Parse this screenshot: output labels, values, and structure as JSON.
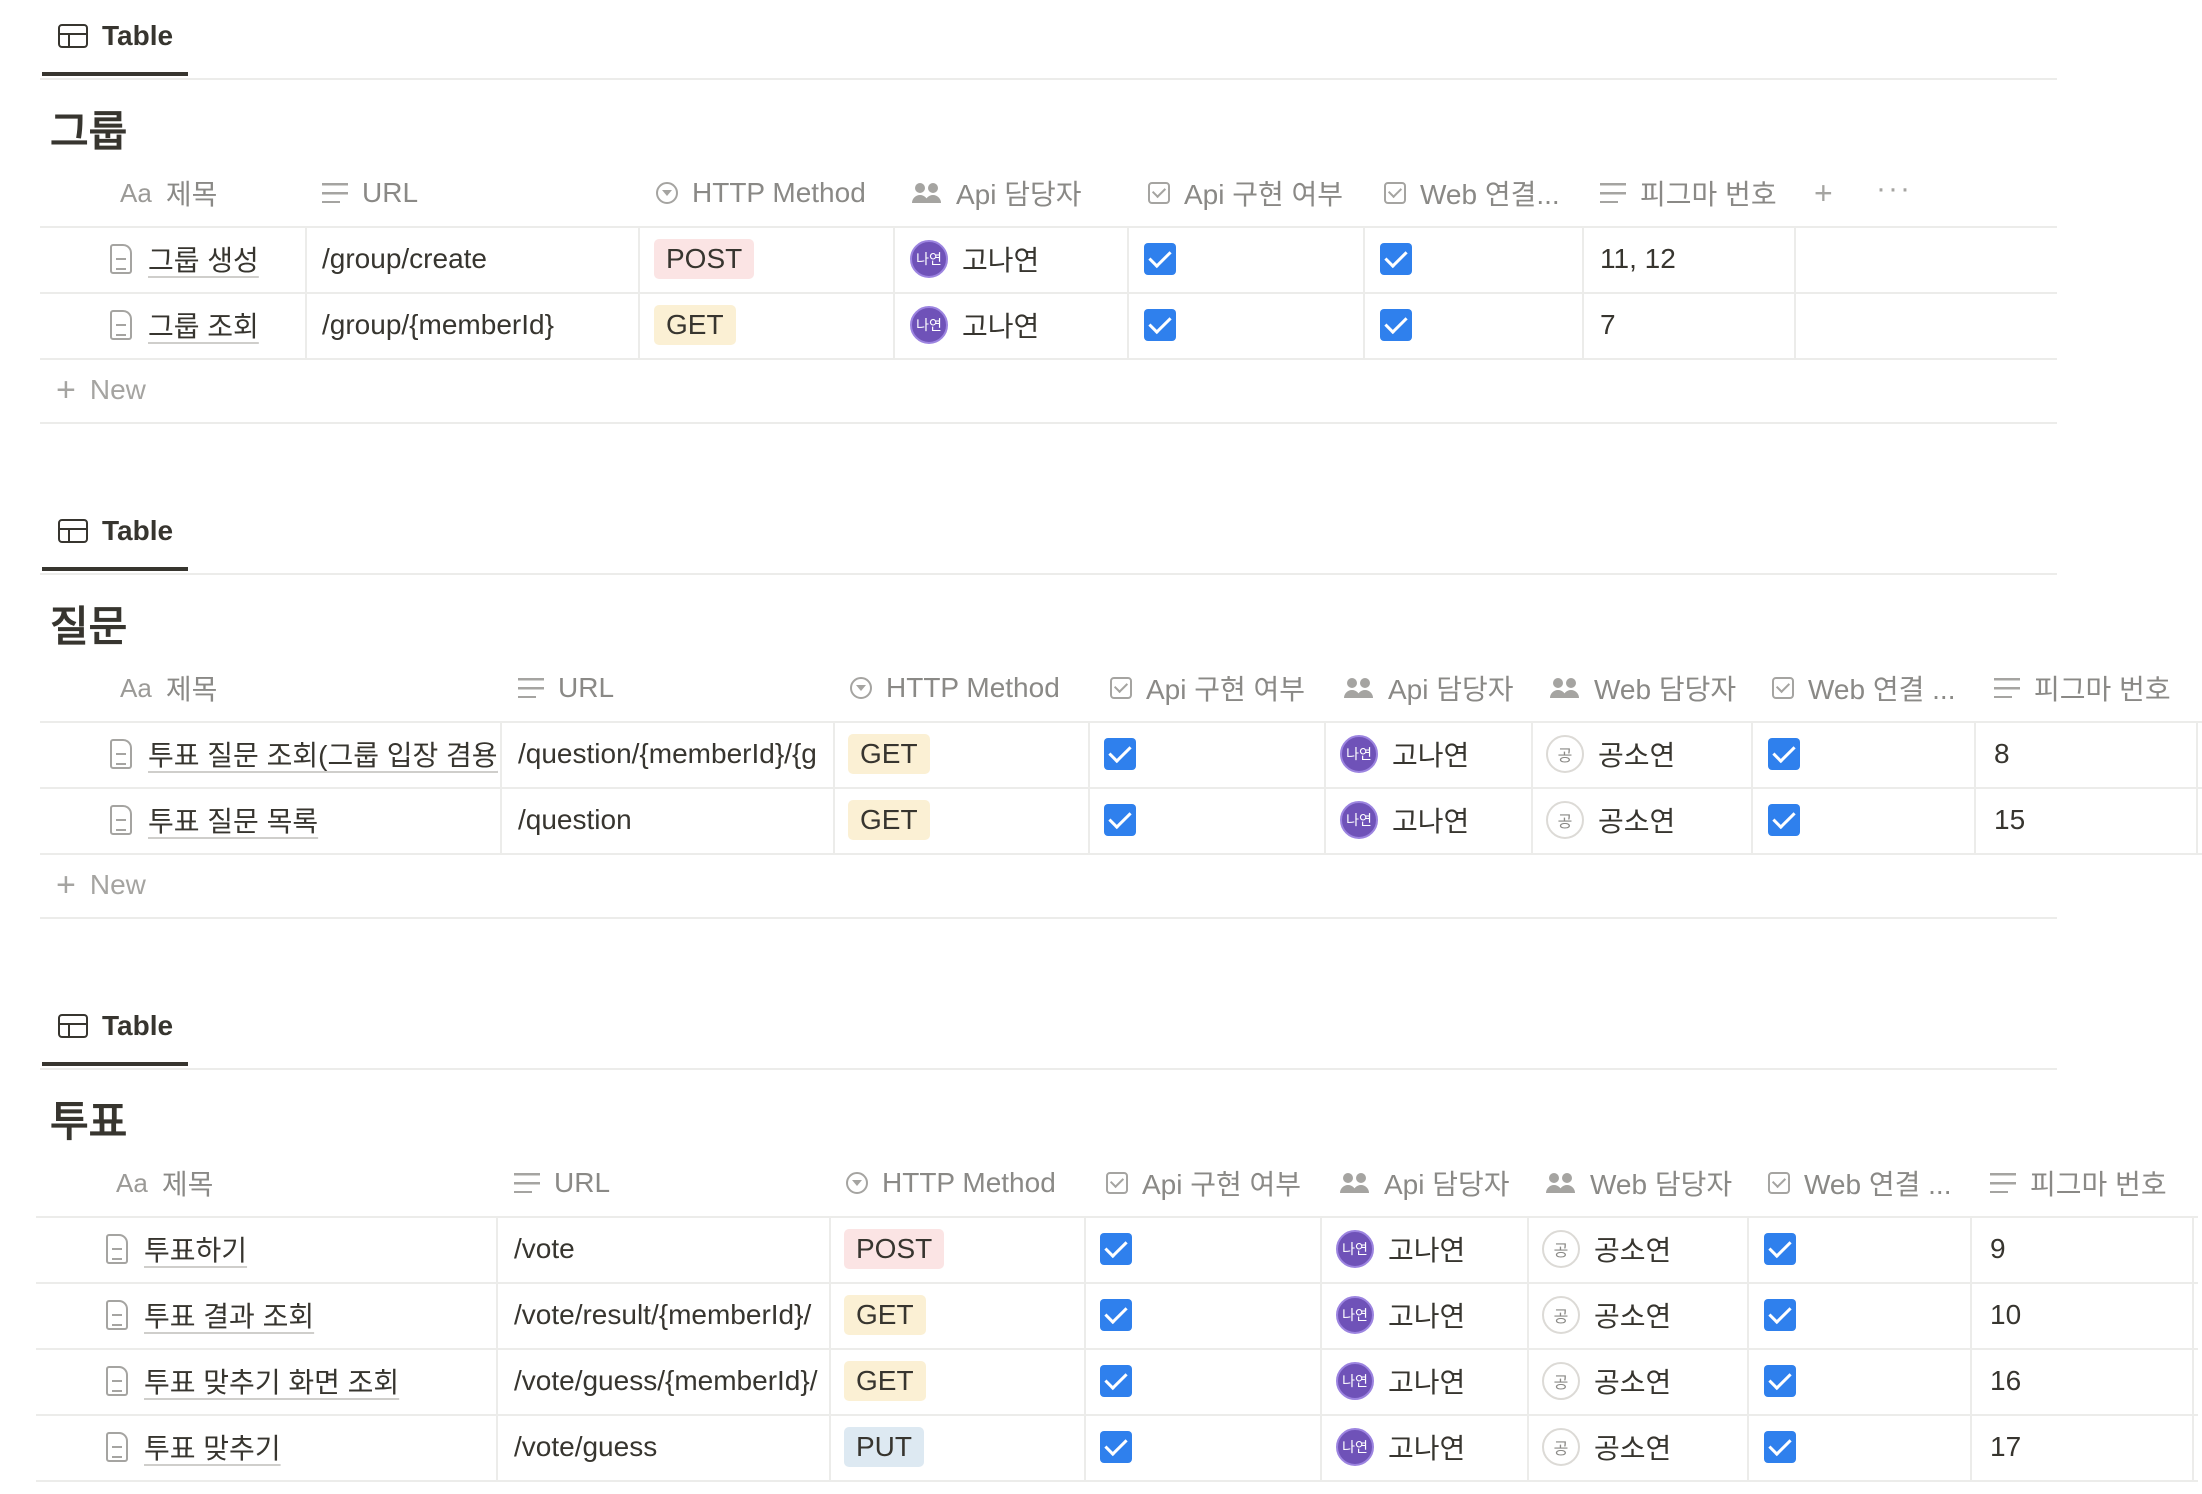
{
  "colors": {
    "checkbox": "#2f80ed",
    "avatar_api": "#6f52b8",
    "tag_post": "#fbe4e4",
    "tag_get": "#fbf0d4",
    "tag_put": "#dde9f2"
  },
  "tables": [
    {
      "view_tab": "Table",
      "title": "그룹",
      "columns": [
        "제목",
        "URL",
        "HTTP Method",
        "Api 담당자",
        "Api 구현 여부",
        "Web 연결...",
        "피그마 번호"
      ],
      "rows": [
        {
          "title": "그룹 생성",
          "url": "/group/create",
          "method": "POST",
          "api_owner": "고나연",
          "api_avatar": "나연",
          "api_done": true,
          "web_done": true,
          "figma": "11, 12"
        },
        {
          "title": "그룹 조회",
          "url": "/group/{memberId}",
          "method": "GET",
          "api_owner": "고나연",
          "api_avatar": "나연",
          "api_done": true,
          "web_done": true,
          "figma": "7"
        }
      ],
      "new_label": "New"
    },
    {
      "view_tab": "Table",
      "title": "질문",
      "columns": [
        "제목",
        "URL",
        "HTTP Method",
        "Api 구현 여부",
        "Api 담당자",
        "Web 담당자",
        "Web 연결 ...",
        "피그마 번호"
      ],
      "rows": [
        {
          "title": "투표 질문 조회(그룹 입장 겸용)",
          "url": "/question/{memberId}/{g",
          "method": "GET",
          "api_done": true,
          "api_owner": "고나연",
          "api_avatar": "나연",
          "web_owner": "공소연",
          "web_avatar": "공",
          "web_done": true,
          "figma": "8"
        },
        {
          "title": "투표 질문 목록",
          "url": "/question",
          "method": "GET",
          "api_done": true,
          "api_owner": "고나연",
          "api_avatar": "나연",
          "web_owner": "공소연",
          "web_avatar": "공",
          "web_done": true,
          "figma": "15"
        }
      ],
      "new_label": "New"
    },
    {
      "view_tab": "Table",
      "title": "투표",
      "columns": [
        "제목",
        "URL",
        "HTTP Method",
        "Api 구현 여부",
        "Api 담당자",
        "Web 담당자",
        "Web 연결 ...",
        "피그마 번호"
      ],
      "rows": [
        {
          "title": "투표하기",
          "url": "/vote",
          "method": "POST",
          "api_done": true,
          "api_owner": "고나연",
          "api_avatar": "나연",
          "web_owner": "공소연",
          "web_avatar": "공",
          "web_done": true,
          "figma": "9"
        },
        {
          "title": "투표 결과 조회",
          "url": "/vote/result/{memberId}/",
          "method": "GET",
          "api_done": true,
          "api_owner": "고나연",
          "api_avatar": "나연",
          "web_owner": "공소연",
          "web_avatar": "공",
          "web_done": true,
          "figma": "10"
        },
        {
          "title": "투표 맞추기 화면 조회",
          "url": "/vote/guess/{memberId}/",
          "method": "GET",
          "api_done": true,
          "api_owner": "고나연",
          "api_avatar": "나연",
          "web_owner": "공소연",
          "web_avatar": "공",
          "web_done": true,
          "figma": "16"
        },
        {
          "title": "투표 맞추기",
          "url": "/vote/guess",
          "method": "PUT",
          "api_done": true,
          "api_owner": "고나연",
          "api_avatar": "나연",
          "web_owner": "공소연",
          "web_avatar": "공",
          "web_done": true,
          "figma": "17"
        }
      ]
    }
  ]
}
